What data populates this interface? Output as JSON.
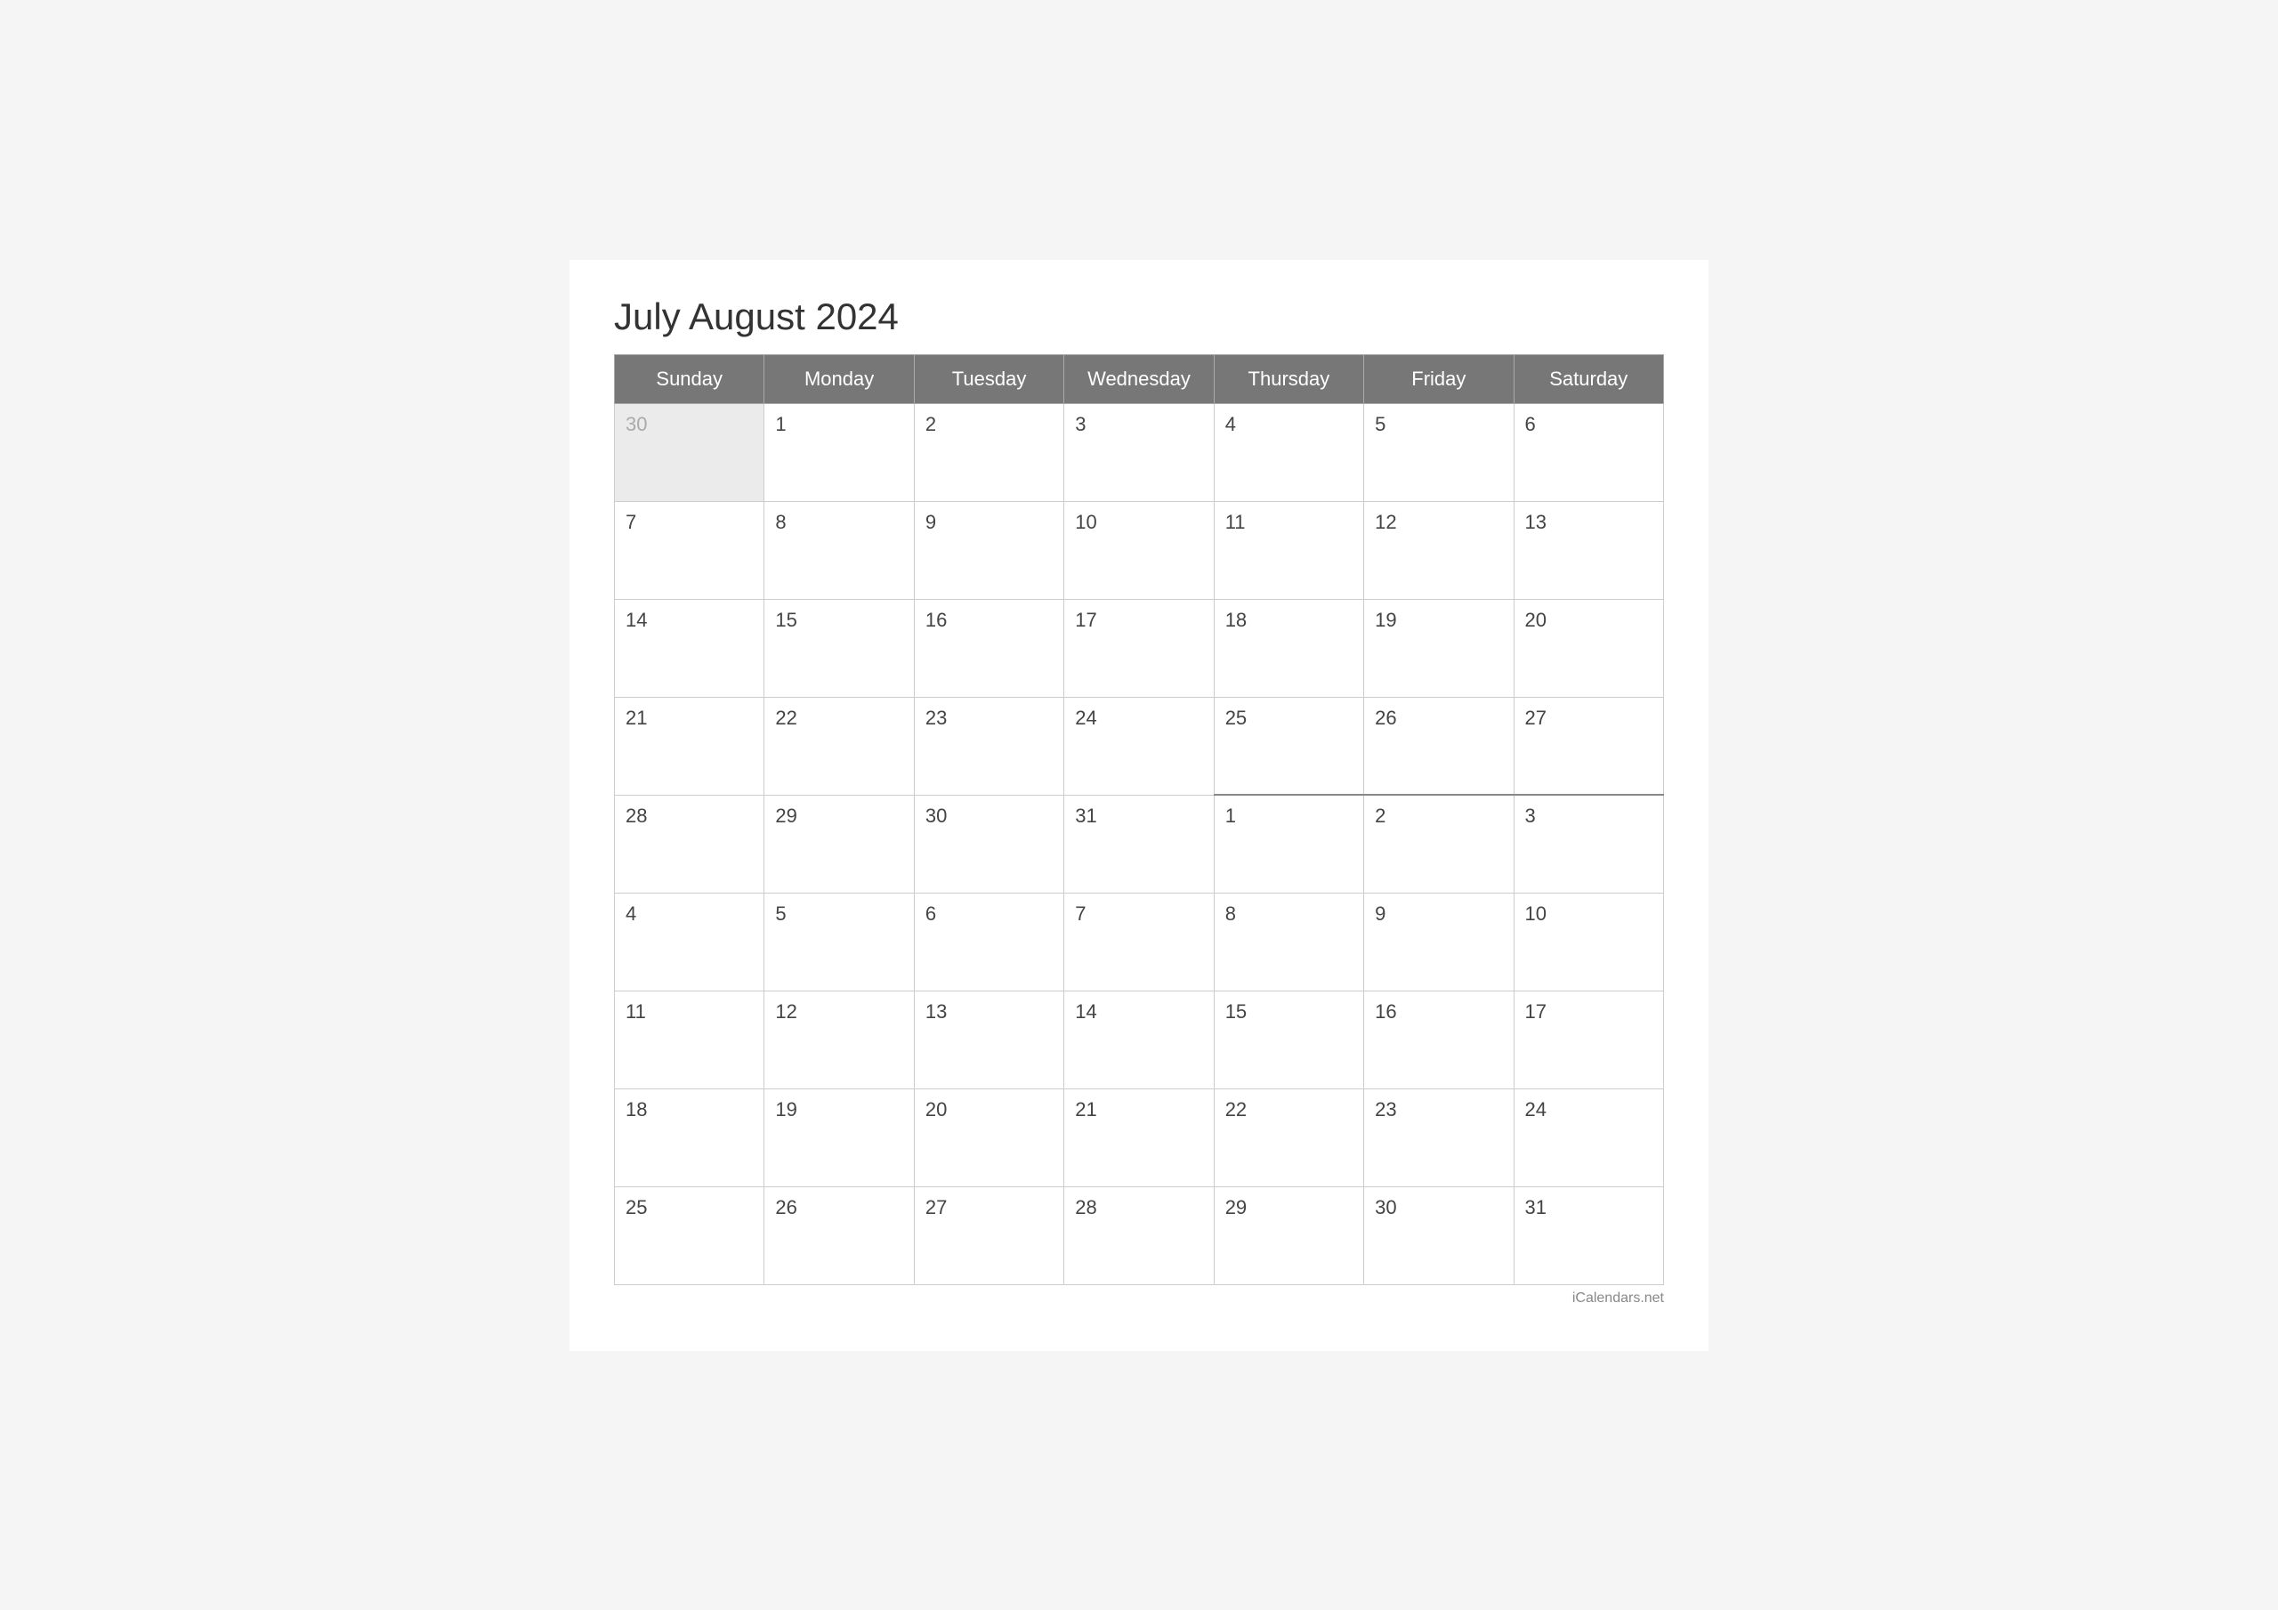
{
  "title": "July August 2024",
  "days_of_week": [
    "Sunday",
    "Monday",
    "Tuesday",
    "Wednesday",
    "Thursday",
    "Friday",
    "Saturday"
  ],
  "weeks": [
    [
      {
        "label": "30",
        "type": "prev-month"
      },
      {
        "label": "1",
        "type": "current"
      },
      {
        "label": "2",
        "type": "current"
      },
      {
        "label": "3",
        "type": "current"
      },
      {
        "label": "4",
        "type": "current"
      },
      {
        "label": "5",
        "type": "current"
      },
      {
        "label": "6",
        "type": "current"
      }
    ],
    [
      {
        "label": "7",
        "type": "current"
      },
      {
        "label": "8",
        "type": "current"
      },
      {
        "label": "9",
        "type": "current"
      },
      {
        "label": "10",
        "type": "current"
      },
      {
        "label": "11",
        "type": "current"
      },
      {
        "label": "12",
        "type": "current"
      },
      {
        "label": "13",
        "type": "current"
      }
    ],
    [
      {
        "label": "14",
        "type": "current"
      },
      {
        "label": "15",
        "type": "current"
      },
      {
        "label": "16",
        "type": "current"
      },
      {
        "label": "17",
        "type": "current"
      },
      {
        "label": "18",
        "type": "current"
      },
      {
        "label": "19",
        "type": "current"
      },
      {
        "label": "20",
        "type": "current"
      }
    ],
    [
      {
        "label": "21",
        "type": "current"
      },
      {
        "label": "22",
        "type": "current"
      },
      {
        "label": "23",
        "type": "current"
      },
      {
        "label": "24",
        "type": "current"
      },
      {
        "label": "25",
        "type": "current"
      },
      {
        "label": "26",
        "type": "current"
      },
      {
        "label": "27",
        "type": "current"
      }
    ],
    [
      {
        "label": "28",
        "type": "current"
      },
      {
        "label": "29",
        "type": "current"
      },
      {
        "label": "30",
        "type": "current"
      },
      {
        "label": "31",
        "type": "current"
      },
      {
        "label": "1",
        "type": "month-divider-left"
      },
      {
        "label": "2",
        "type": "month-divider-left"
      },
      {
        "label": "3",
        "type": "month-divider-left"
      }
    ],
    [
      {
        "label": "4",
        "type": "current"
      },
      {
        "label": "5",
        "type": "current"
      },
      {
        "label": "6",
        "type": "current"
      },
      {
        "label": "7",
        "type": "current"
      },
      {
        "label": "8",
        "type": "current"
      },
      {
        "label": "9",
        "type": "current"
      },
      {
        "label": "10",
        "type": "current"
      }
    ],
    [
      {
        "label": "11",
        "type": "current"
      },
      {
        "label": "12",
        "type": "current"
      },
      {
        "label": "13",
        "type": "current"
      },
      {
        "label": "14",
        "type": "current"
      },
      {
        "label": "15",
        "type": "current"
      },
      {
        "label": "16",
        "type": "current"
      },
      {
        "label": "17",
        "type": "current"
      }
    ],
    [
      {
        "label": "18",
        "type": "current"
      },
      {
        "label": "19",
        "type": "current"
      },
      {
        "label": "20",
        "type": "current"
      },
      {
        "label": "21",
        "type": "current"
      },
      {
        "label": "22",
        "type": "current"
      },
      {
        "label": "23",
        "type": "current"
      },
      {
        "label": "24",
        "type": "current"
      }
    ],
    [
      {
        "label": "25",
        "type": "current"
      },
      {
        "label": "26",
        "type": "current"
      },
      {
        "label": "27",
        "type": "current"
      },
      {
        "label": "28",
        "type": "current"
      },
      {
        "label": "29",
        "type": "current"
      },
      {
        "label": "30",
        "type": "current"
      },
      {
        "label": "31",
        "type": "current"
      }
    ]
  ],
  "footer": "iCalendars.net"
}
